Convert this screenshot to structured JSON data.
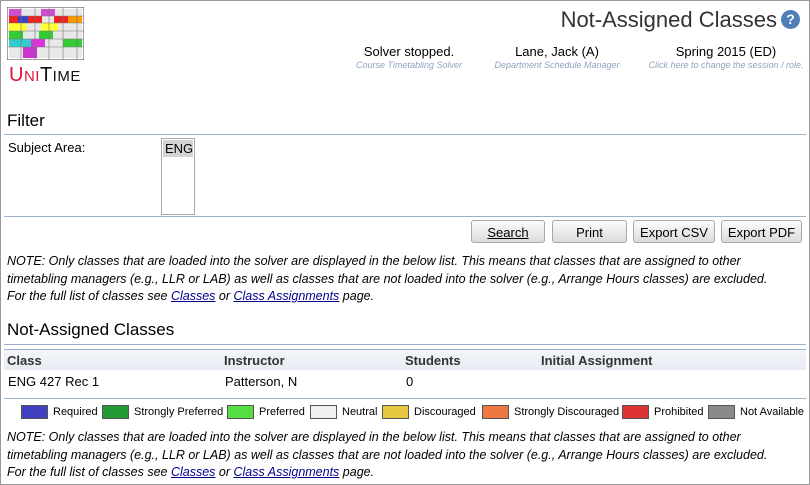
{
  "header": {
    "title": "Not-Assigned Classes",
    "solver_status": "Solver stopped.",
    "solver_sub": "Course Timetabling Solver",
    "user": "Lane, Jack (A)",
    "user_sub": "Department Schedule Manager",
    "session": "Spring 2015 (ED)",
    "session_sub": "Click here to change the session / role.",
    "help_icon": "?"
  },
  "logo": {
    "text": "UniTime"
  },
  "filter": {
    "title": "Filter",
    "subject_label": "Subject Area:",
    "subject_selected": "ENG"
  },
  "buttons": {
    "search": "Search",
    "print": "Print",
    "export_csv": "Export CSV",
    "export_pdf": "Export PDF"
  },
  "note": {
    "line1": "NOTE: Only classes that are loaded into the solver are displayed in the below list. This means that classes that are assigned to other",
    "line2": "timetabling managers (e.g., LLR or LAB) as well as classes that are not loaded into the solver (e.g., Arrange Hours classes) are excluded.",
    "line3_prefix": "For the full list of classes see ",
    "link_classes": "Classes",
    "or_text": " or ",
    "link_assignments": "Class Assignments",
    "line3_suffix": " page."
  },
  "results": {
    "title": "Not-Assigned Classes",
    "columns": [
      "Class",
      "Instructor",
      "Students",
      "Initial Assignment"
    ],
    "rows": [
      {
        "class": "ENG 427 Rec 1",
        "instructor": "Patterson, N",
        "students": "0",
        "initial": ""
      }
    ]
  },
  "legend": [
    {
      "label": "Required",
      "color": "#4040c0"
    },
    {
      "label": "Strongly Preferred",
      "color": "#229933"
    },
    {
      "label": "Preferred",
      "color": "#55dd44"
    },
    {
      "label": "Neutral",
      "color": "#f0f0f0"
    },
    {
      "label": "Discouraged",
      "color": "#e8c840"
    },
    {
      "label": "Strongly Discouraged",
      "color": "#ee7744"
    },
    {
      "label": "Prohibited",
      "color": "#dd3333"
    },
    {
      "label": "Not Available",
      "color": "#8a8a8a"
    }
  ]
}
